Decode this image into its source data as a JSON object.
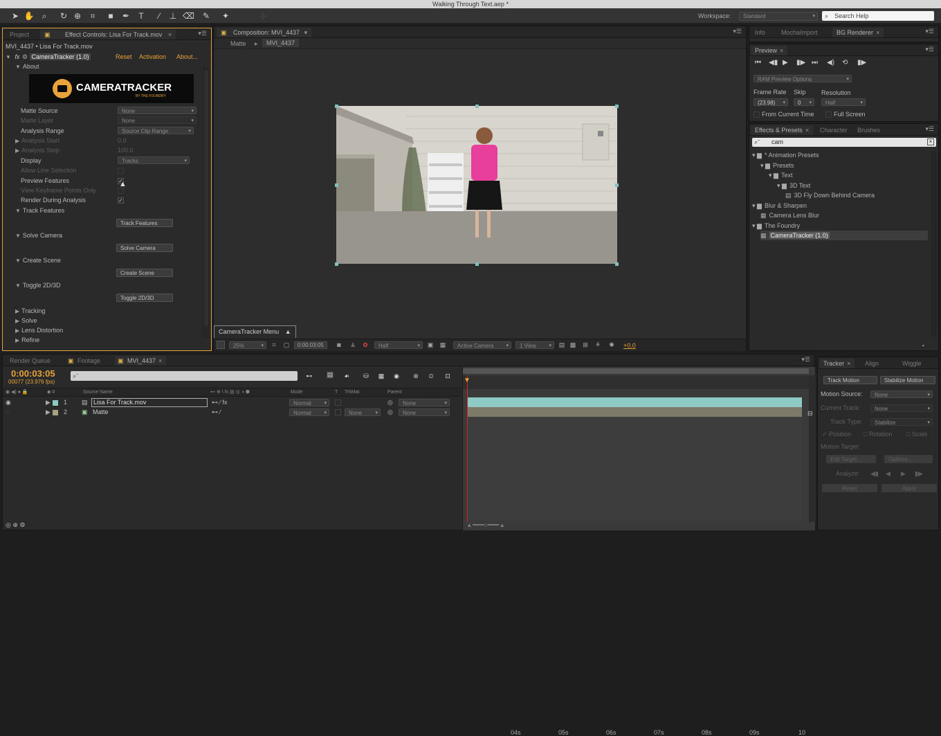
{
  "window": {
    "title": "Walking Through Text.aep *"
  },
  "toolbar": {
    "workspace_label": "Workspace:",
    "workspace_value": "Standard",
    "search_placeholder": "Search Help"
  },
  "effect_panel": {
    "tabs": [
      "Project",
      "Effect Controls: Lisa For Track.mov"
    ],
    "breadcrumb": "MVI_4437 • Lisa For Track.mov",
    "effect_name": "CameraTracker (1.0)",
    "fx_label": "fx",
    "links": [
      "Reset",
      "Activation",
      "About..."
    ],
    "about_label": "About",
    "logo_text": "CAMERATRACKER",
    "logo_sub": "BY THE FOUNDRY",
    "props": [
      {
        "label": "Matte Source",
        "value": "None"
      },
      {
        "label": "Matte Layer",
        "value": "None"
      },
      {
        "label": "Analysis Range",
        "value": "Source Clip Range"
      },
      {
        "label": "Analysis Start",
        "value": "0.0"
      },
      {
        "label": "Analysis Stop",
        "value": "100.0"
      },
      {
        "label": "Display",
        "value": "Tracks"
      },
      {
        "label": "Allow Line Selection",
        "value": ""
      },
      {
        "label": "Preview Features",
        "value": ""
      },
      {
        "label": "View Keyframe Points Only",
        "value": ""
      },
      {
        "label": "Render During Analysis",
        "value": ""
      }
    ],
    "sections": [
      {
        "label": "Track Features",
        "button": "Track Features"
      },
      {
        "label": "Solve Camera",
        "button": "Solve Camera"
      },
      {
        "label": "Create Scene",
        "button": "Create Scene"
      },
      {
        "label": "Toggle 2D/3D",
        "button": "Toggle 2D/3D"
      }
    ],
    "collapsed": [
      "Tracking",
      "Solve",
      "Lens Distortion",
      "Refine"
    ]
  },
  "composition": {
    "tab": "Composition: MVI_4437",
    "crumbs": [
      "Matte",
      "MVI_4437"
    ],
    "menu_tab": "CameraTracker Menu",
    "footer": {
      "zoom": "25%",
      "timecode": "0:00:03:05",
      "resolution": "Half",
      "camera": "Active Camera",
      "view": "1 View",
      "exposure": "+0.0"
    }
  },
  "right_top": {
    "tabs": [
      "Info",
      "MochaImport",
      "BG Renderer"
    ]
  },
  "preview": {
    "title": "Preview",
    "ram_options": "RAM Preview Options",
    "frame_rate_label": "Frame Rate",
    "skip_label": "Skip",
    "resolution_label": "Resolution",
    "frame_rate": "(23.98)",
    "skip": "0",
    "resolution": "Half",
    "from_current": "From Current Time",
    "full_screen": "Full Screen"
  },
  "effects_presets": {
    "tabs": [
      "Effects & Presets",
      "Character",
      "Brushes"
    ],
    "search": "cam",
    "tree": [
      {
        "label": "* Animation Presets",
        "indent": 0,
        "kind": "folder-open"
      },
      {
        "label": "Presets",
        "indent": 1,
        "kind": "folder-open"
      },
      {
        "label": "Text",
        "indent": 2,
        "kind": "folder-open"
      },
      {
        "label": "3D Text",
        "indent": 3,
        "kind": "folder-open"
      },
      {
        "label": "3D Fly Down Behind Camera",
        "indent": 4,
        "kind": "preset"
      },
      {
        "label": "Blur & Sharpen",
        "indent": 0,
        "kind": "folder-open"
      },
      {
        "label": "Camera Lens Blur",
        "indent": 1,
        "kind": "effect"
      },
      {
        "label": "The Foundry",
        "indent": 0,
        "kind": "folder-open"
      },
      {
        "label": "CameraTracker (1.0)",
        "indent": 1,
        "kind": "effect-selected"
      }
    ]
  },
  "timeline": {
    "tabs": [
      "Render Queue",
      "Footage",
      "MVI_4437"
    ],
    "timecode": "0:00:03:05",
    "frame_info": "00077 (23.976 fps)",
    "search_placeholder": "",
    "headers": {
      "source": "Source Name",
      "mode": "Mode",
      "t": "T",
      "trkmat": "TrkMat",
      "parent": "Parent"
    },
    "layers": [
      {
        "num": "1",
        "name": "Lisa For Track.mov",
        "mode": "Normal",
        "trkmat": "",
        "parent": "None"
      },
      {
        "num": "2",
        "name": "Matte",
        "mode": "Normal",
        "trkmat": "None",
        "parent": "None"
      }
    ],
    "ruler": [
      "04s",
      "05s",
      "06s",
      "07s",
      "08s",
      "09s",
      "10"
    ]
  },
  "tracker": {
    "tabs": [
      "Tracker",
      "Align",
      "Wiggle"
    ],
    "track_motion": "Track Motion",
    "stabilize_motion": "Stabilize Motion",
    "motion_source_label": "Motion Source:",
    "motion_source": "None",
    "current_track_label": "Current Track:",
    "current_track": "None",
    "track_type_label": "Track Type:",
    "track_type": "Stabilize",
    "position": "Position",
    "rotation": "Rotation",
    "scale": "Scale",
    "motion_target_label": "Motion Target:",
    "edit_target": "Edit Target...",
    "options": "Options...",
    "analyze": "Analyze:",
    "reset": "Reset",
    "apply": "Apply"
  },
  "colors": {
    "accent_orange": "#e9a33a",
    "clip_teal": "#8ecbc6",
    "playhead": "#d22"
  }
}
